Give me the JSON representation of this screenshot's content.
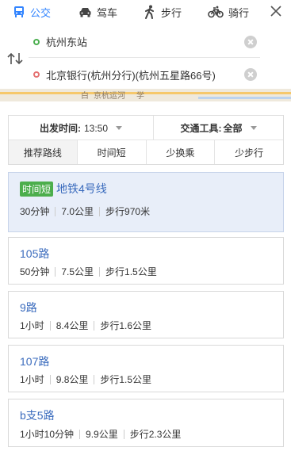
{
  "modes": [
    {
      "label": "公交",
      "icon": "bus-icon",
      "active": true
    },
    {
      "label": "驾车",
      "icon": "car-icon",
      "active": false
    },
    {
      "label": "步行",
      "icon": "walk-icon",
      "active": false
    },
    {
      "label": "骑行",
      "icon": "bike-icon",
      "active": false
    }
  ],
  "route": {
    "start": "杭州东站",
    "end": "北京银行(杭州分行)(杭州五星路66号)"
  },
  "map_labels": [
    "白",
    "京杭运河",
    "学"
  ],
  "filters": {
    "depart_label": "出发时间:",
    "depart_value": "13:50",
    "transport_label": "交通工具:",
    "transport_value": "全部",
    "tabs": [
      "推荐路线",
      "时间短",
      "少换乘",
      "少步行"
    ],
    "active_tab": 0
  },
  "routes": [
    {
      "badge": "时间短",
      "name": "地铁4号线",
      "duration": "30分钟",
      "distance": "7.0公里",
      "walk": "步行970米",
      "selected": true
    },
    {
      "badge": "",
      "name": "105路",
      "duration": "50分钟",
      "distance": "7.5公里",
      "walk": "步行1.5公里",
      "selected": false
    },
    {
      "badge": "",
      "name": "9路",
      "duration": "1小时",
      "distance": "8.4公里",
      "walk": "步行1.6公里",
      "selected": false
    },
    {
      "badge": "",
      "name": "107路",
      "duration": "1小时",
      "distance": "9.8公里",
      "walk": "步行1.5公里",
      "selected": false
    },
    {
      "badge": "",
      "name": "b支5路",
      "duration": "1小时10分钟",
      "distance": "9.9公里",
      "walk": "步行2.3公里",
      "selected": false
    }
  ],
  "colors": {
    "accent": "#3385ff",
    "badge": "#4cae4c",
    "selected_card": "#e8eef9",
    "start_dot": "#4caf50",
    "end_dot": "#e57373"
  }
}
